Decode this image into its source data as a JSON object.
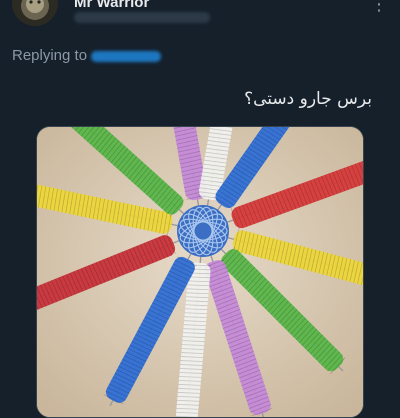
{
  "tweet": {
    "author": {
      "display_name": "Mr Warrior"
    },
    "replying_label": "Replying to",
    "text": "برس جارو دستی؟",
    "more_icon": "more-options-icon",
    "media": {
      "description_icon": "photo"
    }
  },
  "colors": {
    "background": "#15202b",
    "primary_text": "#e7e9ea",
    "secondary_text": "#8b98a5",
    "link": "#1d9bf0",
    "border": "#38444d"
  }
}
